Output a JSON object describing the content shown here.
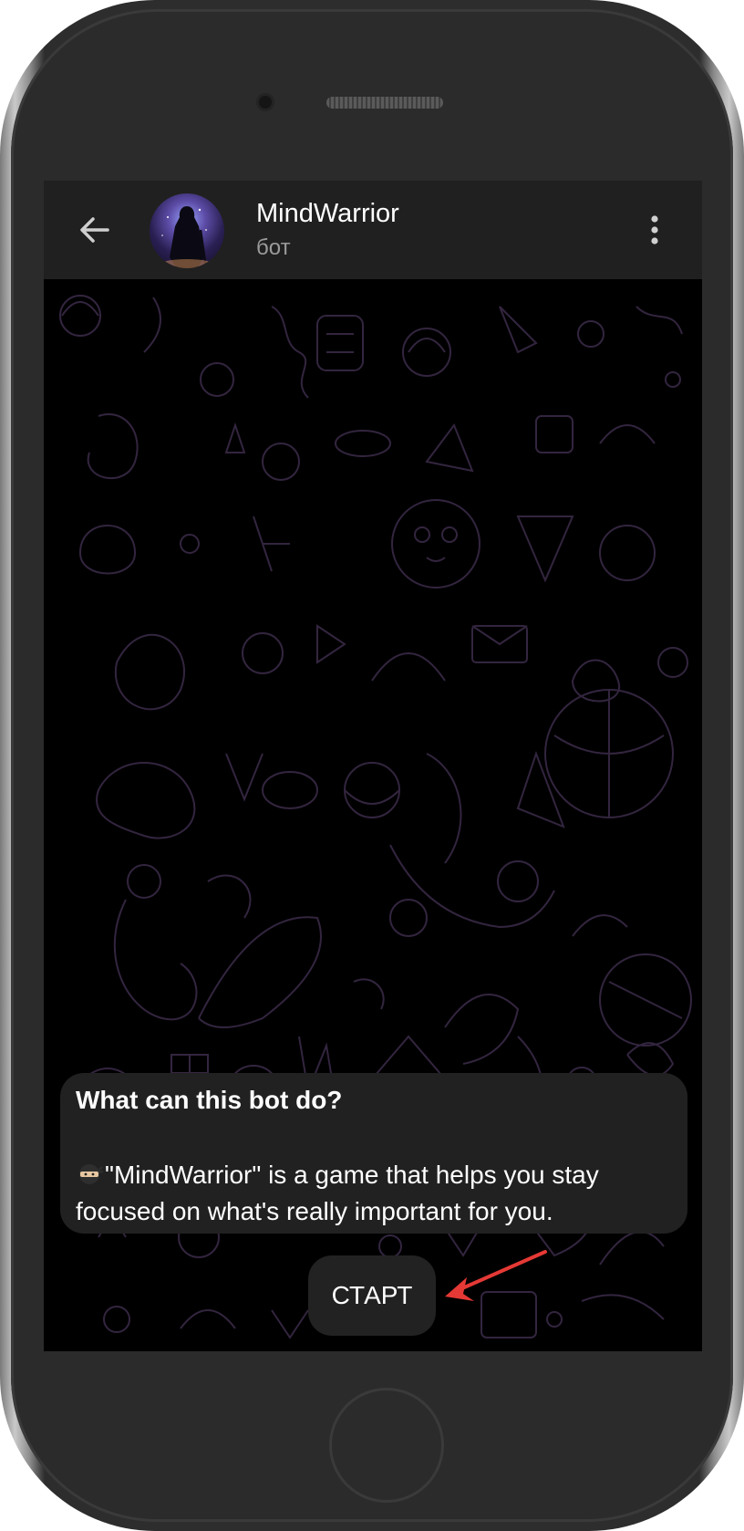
{
  "chat": {
    "name": "MindWarrior",
    "status": "бот"
  },
  "intro": {
    "title": "What can this bot do?",
    "description": "\"MindWarrior\" is a game that helps you stay focused on what's really important for you."
  },
  "start_button": {
    "label": "СТАРТ"
  },
  "icons": {
    "back": "arrow-left-icon",
    "menu": "more-vertical-icon",
    "emoji": "ninja-emoji",
    "annotation": "red-arrow-icon"
  },
  "colors": {
    "header_bg": "#202020",
    "chat_bg": "#000000",
    "bubble_bg": "#212121",
    "arrow": "#e53935",
    "doodle": "#3a2a48"
  }
}
